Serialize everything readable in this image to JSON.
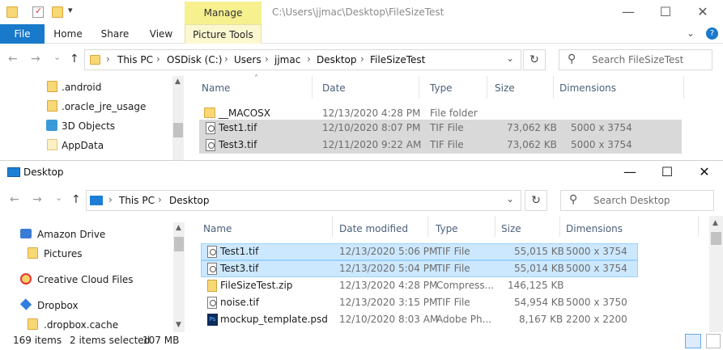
{
  "window1": {
    "title_path": "C:\\Users\\jjmac\\Desktop\\FileSizeTest",
    "contextual_tab": "Manage",
    "ribbon_tabs": [
      "File",
      "Home",
      "Share",
      "View",
      "Picture Tools"
    ],
    "breadcrumb": [
      "This PC",
      "OSDisk (C:)",
      "Users",
      "jjmac",
      "Desktop",
      "FileSizeTest"
    ],
    "search_placeholder": "Search FileSizeTest",
    "nav_items": [
      ".android",
      ".oracle_jre_usage",
      "3D Objects",
      "AppData"
    ],
    "columns": [
      "Name",
      "Date",
      "Type",
      "Size",
      "Dimensions"
    ],
    "rows": [
      {
        "name": "__MACOSX",
        "date": "12/13/2020 4:28 PM",
        "type": "File folder",
        "size": "",
        "dims": ""
      },
      {
        "name": "Test1.tif",
        "date": "12/10/2020 8:07 PM",
        "type": "TIF File",
        "size": "73,062 KB",
        "dims": "5000 x 3754"
      },
      {
        "name": "Test3.tif",
        "date": "12/11/2020 9:22 AM",
        "type": "TIF File",
        "size": "73,062 KB",
        "dims": "5000 x 3754"
      }
    ]
  },
  "window2": {
    "title": "Desktop",
    "breadcrumb": [
      "This PC",
      "Desktop"
    ],
    "search_placeholder": "Search Desktop",
    "nav_items": [
      "Amazon Drive",
      "Pictures",
      "Creative Cloud Files",
      "Dropbox",
      ".dropbox.cache"
    ],
    "columns": [
      "Name",
      "Date modified",
      "Type",
      "Size",
      "Dimensions"
    ],
    "rows": [
      {
        "name": "Test1.tif",
        "date": "12/13/2020 5:06 PM",
        "type": "TIF File",
        "size": "55,015 KB",
        "dims": "5000 x 3754"
      },
      {
        "name": "Test3.tif",
        "date": "12/13/2020 5:04 PM",
        "type": "TIF File",
        "size": "55,014 KB",
        "dims": "5000 x 3754"
      },
      {
        "name": "FileSizeTest.zip",
        "date": "12/13/2020 4:28 PM",
        "type": "Compress...",
        "size": "146,125 KB",
        "dims": ""
      },
      {
        "name": "noise.tif",
        "date": "12/13/2020 3:15 PM",
        "type": "TIF File",
        "size": "54,954 KB",
        "dims": "5000 x 3750"
      },
      {
        "name": "mockup_template.psd",
        "date": "12/10/2020 8:03 AM",
        "type": "Adobe Ph...",
        "size": "8,167 KB",
        "dims": "2200 x 2200"
      }
    ],
    "status": {
      "items": "169 items",
      "selected": "2 items selected",
      "size": "107 MB"
    }
  },
  "glyphs": {
    "minimize": "—",
    "maximize": "☐",
    "close": "✕",
    "back": "←",
    "forward": "→",
    "up": "↑",
    "chevron_down": "⌄",
    "chevron_right": "›",
    "refresh": "↻",
    "search": "⚲",
    "help": "?",
    "expand_ribbon": "⌄"
  }
}
